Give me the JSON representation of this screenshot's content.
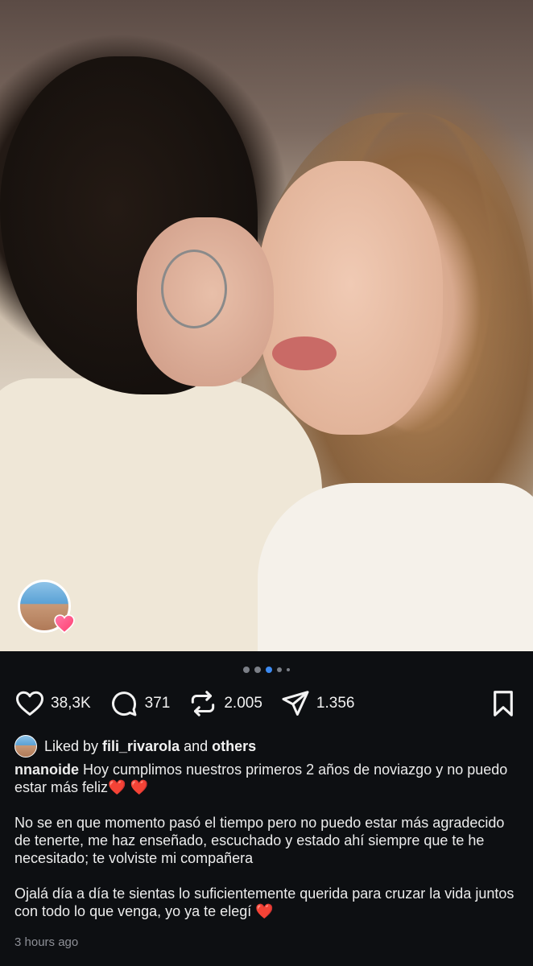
{
  "post": {
    "carousel": {
      "count": 5,
      "active_index": 2
    },
    "likes": "38,3K",
    "comments": "371",
    "reposts": "2.005",
    "shares": "1.356"
  },
  "liked_by": {
    "prefix": "Liked by",
    "user": "fili_rivarola",
    "connector": "and",
    "suffix": "others"
  },
  "caption": {
    "username": "nnanoide",
    "line1": "Hoy cumplimos nuestros primeros 2 años de noviazgo y no puedo estar más feliz",
    "line1_emoji": "❤️ ❤️",
    "paragraph2": "No se en que momento pasó el tiempo pero no puedo estar más agradecido de tenerte, me haz enseñado, escuchado y estado ahí siempre que te he necesitado; te volviste mi compañera",
    "paragraph3": "Ojalá día a día te sientas lo suficientemente querida para cruzar la vida juntos con todo lo que venga, yo ya te elegí",
    "paragraph3_emoji": "❤️"
  },
  "timestamp": "3 hours ago",
  "icons": {
    "like": "heart-icon",
    "comment": "comment-bubble-icon",
    "repost": "repost-arrows-icon",
    "share": "paper-plane-icon",
    "save": "bookmark-icon"
  },
  "colors": {
    "background": "#0d0f12",
    "active_dot": "#3d8bf2",
    "heart_red": "#e43a2e"
  }
}
